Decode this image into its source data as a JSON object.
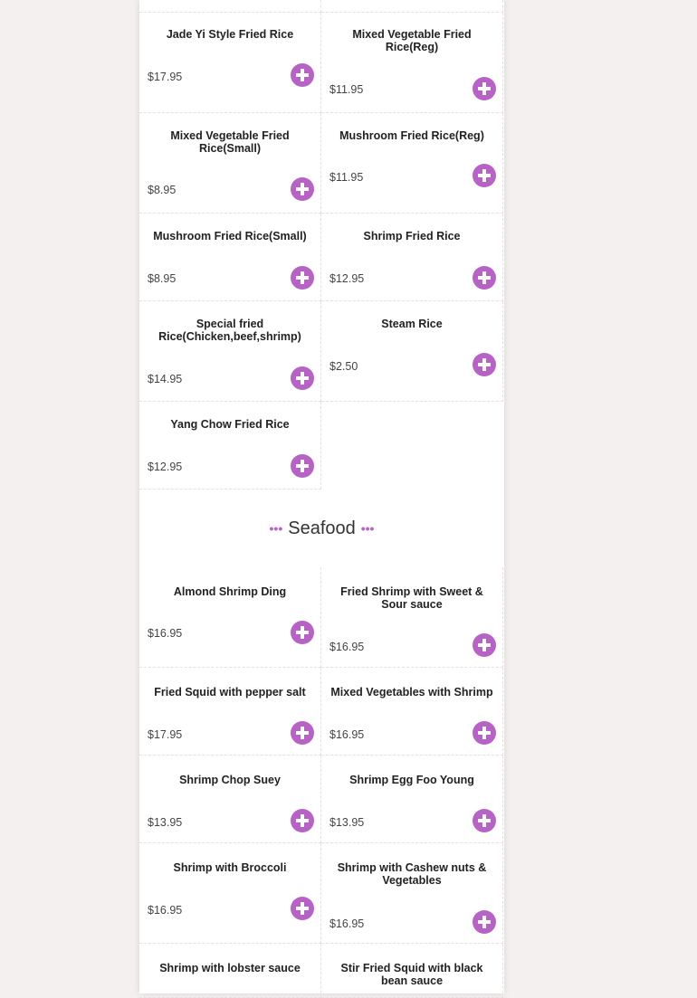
{
  "colors": {
    "accent": "#b763c6",
    "background": "#f5f0f0",
    "panel": "#ffffff"
  },
  "icons": {
    "add": "plus-circle-icon"
  },
  "rice_items": [
    {
      "name": "Jade Yi Style Fried Rice",
      "price": "$17.95"
    },
    {
      "name": "Mixed Vegetable Fried Rice(Reg)",
      "price": "$11.95"
    },
    {
      "name": "Mixed Vegetable Fried Rice(Small)",
      "price": "$8.95"
    },
    {
      "name": "Mushroom Fried Rice(Reg)",
      "price": "$11.95"
    },
    {
      "name": "Mushroom Fried Rice(Small)",
      "price": "$8.95"
    },
    {
      "name": "Shrimp Fried Rice",
      "price": "$12.95"
    },
    {
      "name": "Special fried Rice(Chicken,beef,shrimp)",
      "price": "$14.95"
    },
    {
      "name": "Steam Rice",
      "price": "$2.50"
    },
    {
      "name": "Yang Chow Fried Rice",
      "price": "$12.95"
    }
  ],
  "seafood_section": {
    "title": "Seafood",
    "dots": "•••"
  },
  "seafood_items": [
    {
      "name": "Almond Shrimp Ding",
      "price": "$16.95"
    },
    {
      "name": "Fried Shrimp with Sweet & Sour sauce",
      "price": "$16.95"
    },
    {
      "name": "Fried Squid with pepper salt",
      "price": "$17.95"
    },
    {
      "name": "Mixed Vegetables with Shrimp",
      "price": "$16.95"
    },
    {
      "name": "Shrimp Chop Suey",
      "price": "$13.95"
    },
    {
      "name": "Shrimp Egg Foo Young",
      "price": "$13.95"
    },
    {
      "name": "Shrimp with Broccoli",
      "price": "$16.95"
    },
    {
      "name": "Shrimp with Cashew nuts & Vegetables",
      "price": "$16.95"
    },
    {
      "name": "Shrimp with lobster sauce",
      "price": ""
    },
    {
      "name": "Stir Fried Squid with black bean sauce",
      "price": ""
    }
  ]
}
